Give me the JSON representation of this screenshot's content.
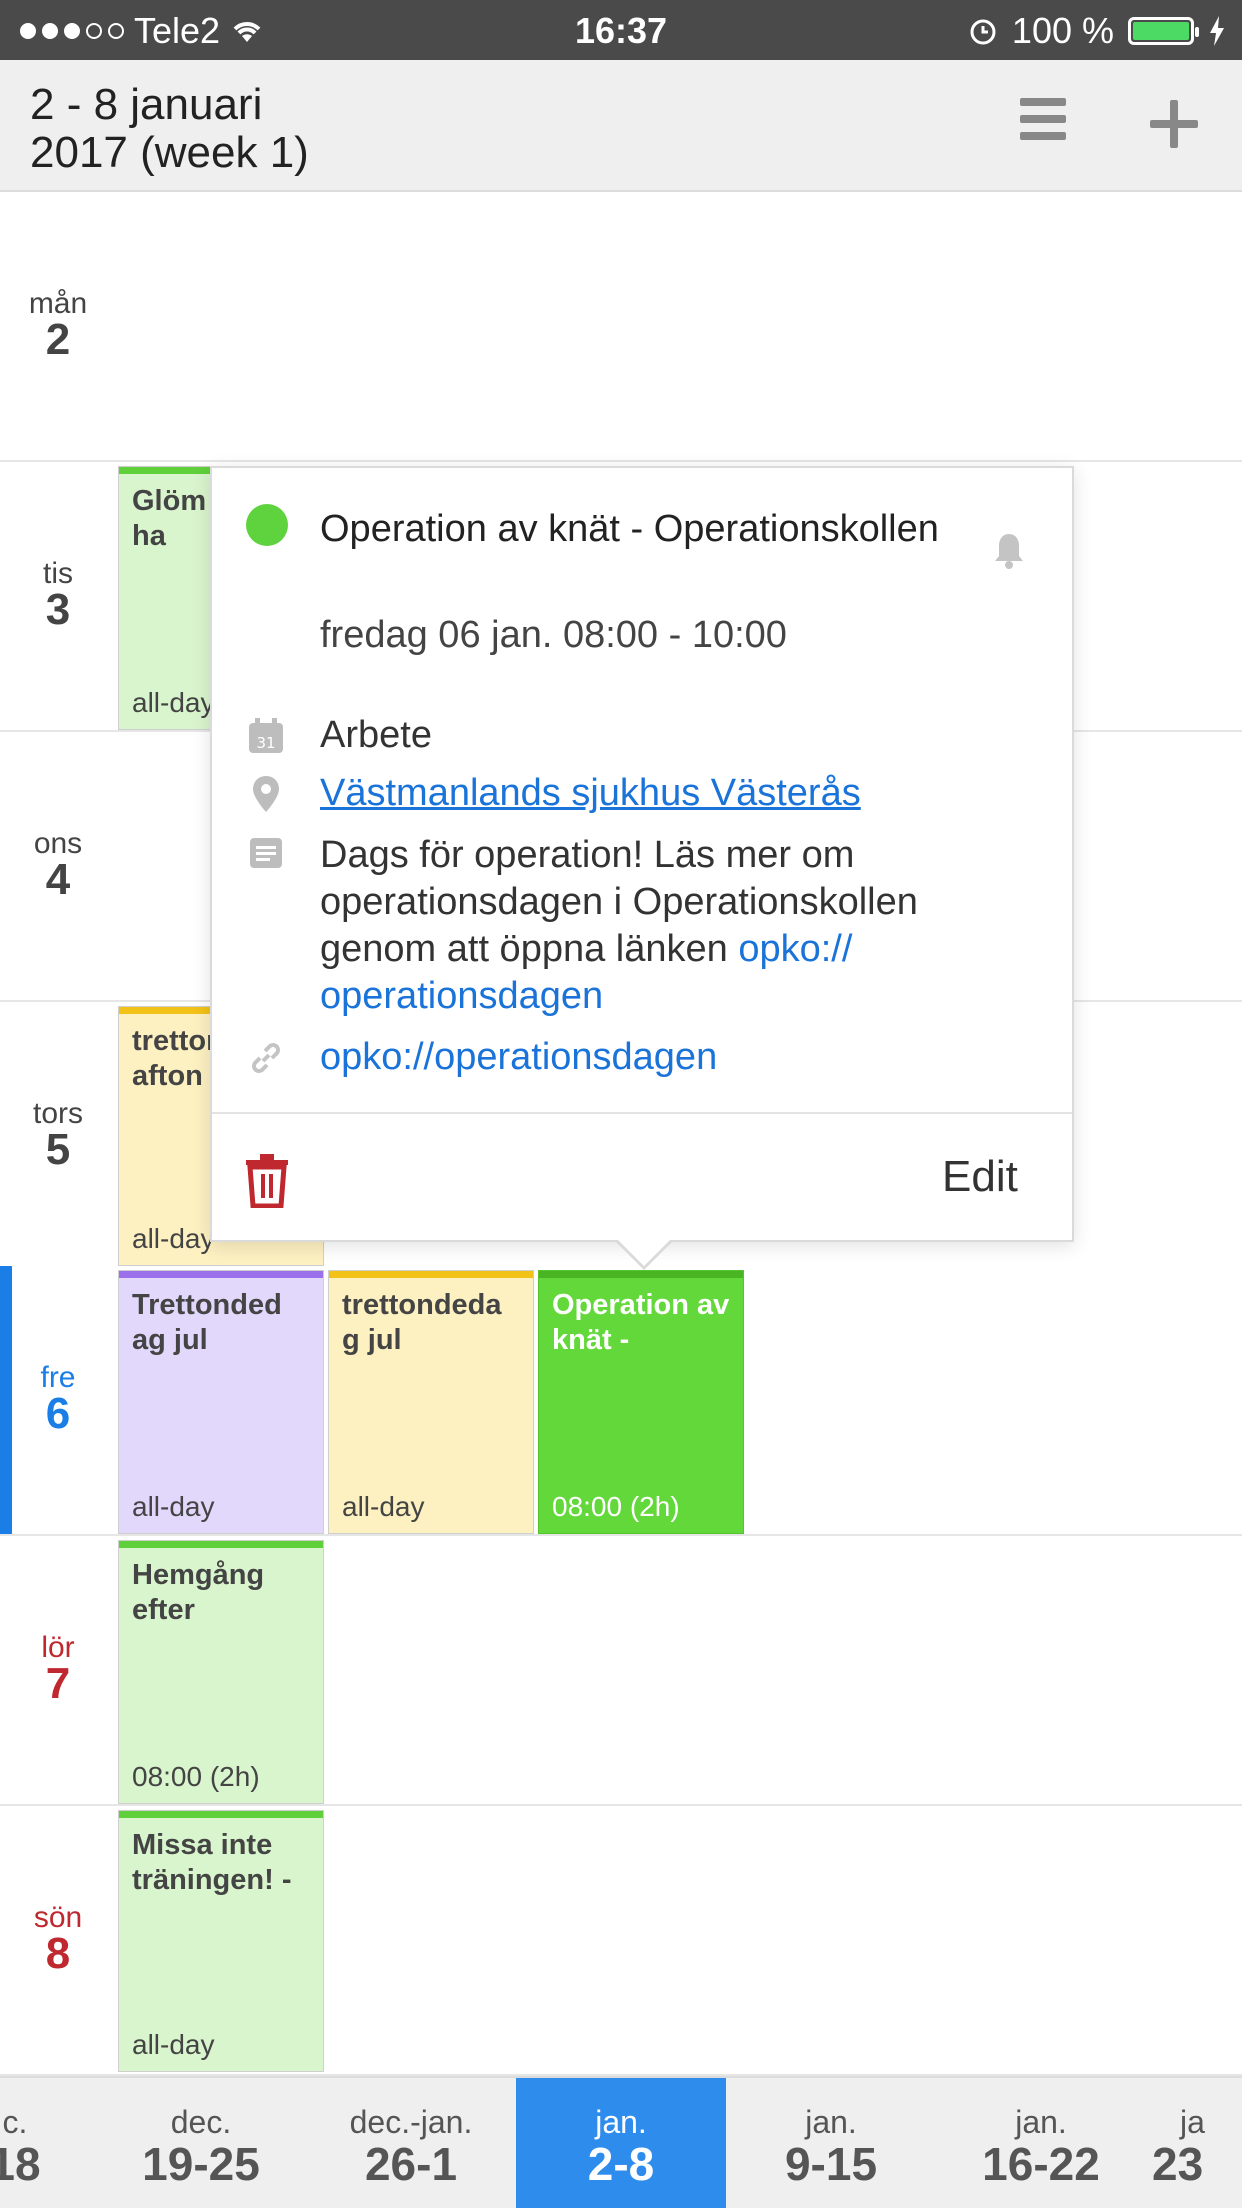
{
  "status_bar": {
    "carrier": "Tele2",
    "time": "16:37",
    "battery": "100 %",
    "icons": [
      "signal-dots-icon",
      "wifi-icon",
      "alarm-icon",
      "battery-icon",
      "charging-icon"
    ]
  },
  "header": {
    "title_line1": "2 - 8 januari",
    "title_line2": "2017 (week 1)",
    "menu_icon": "hamburger-menu-icon",
    "add_icon": "plus-icon"
  },
  "days": [
    {
      "name": "mån",
      "num": "2"
    },
    {
      "name": "tis",
      "num": "3"
    },
    {
      "name": "ons",
      "num": "4"
    },
    {
      "name": "tors",
      "num": "5"
    },
    {
      "name": "fre",
      "num": "6"
    },
    {
      "name": "lör",
      "num": "7"
    },
    {
      "name": "sön",
      "num": "8"
    }
  ],
  "events": {
    "tue": {
      "title": "Glöm inte att ha",
      "time": "all-day"
    },
    "thu": {
      "title": "trettondags afton",
      "time": "all-day"
    },
    "fri1": {
      "title": "Trettonded ag jul",
      "time": "all-day"
    },
    "fri2": {
      "title": "trettondeda g jul",
      "time": "all-day"
    },
    "fri3": {
      "title": "Operation av knät -",
      "time": "08:00 (2h)"
    },
    "sat": {
      "title": "Hemgång efter",
      "time": "08:00 (2h)"
    },
    "sun": {
      "title": "Missa inte träningen! -",
      "time": "all-day"
    }
  },
  "popup": {
    "title": "Operation av knät - Operationskollen",
    "date": "fredag 06 jan. 08:00 - 10:00",
    "calendar": "Arbete",
    "location": "Västmanlands sjukhus Västerås",
    "description": "Dags för operation! Läs mer om operationsdagen i Operationskollen genom att öppna länken",
    "description_link": "opko:// operationsdagen",
    "url": "opko://operationsdagen",
    "edit_label": "Edit",
    "colors": {
      "event": "#5fd33d",
      "link": "#1a73d9",
      "delete": "#c0282f"
    }
  },
  "week_strip": [
    {
      "month": "c.",
      "range": "18"
    },
    {
      "month": "dec.",
      "range": "19-25"
    },
    {
      "month": "dec.-jan.",
      "range": "26-1"
    },
    {
      "month": "jan.",
      "range": "2-8"
    },
    {
      "month": "jan.",
      "range": "9-15"
    },
    {
      "month": "jan.",
      "range": "16-22"
    },
    {
      "month": "ja",
      "range": "23"
    }
  ],
  "colors": {
    "accent": "#1a7ee6",
    "weekend": "#c0282f",
    "selected_week": "#2d8cec"
  }
}
